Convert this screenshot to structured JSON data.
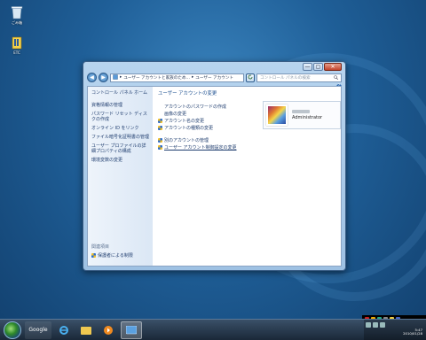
{
  "desktop": {
    "icons": [
      {
        "label": "ごみ箱",
        "icon": "recycle-bin-icon"
      },
      {
        "label": "ETC",
        "icon": "folder-icon"
      }
    ]
  },
  "window": {
    "caption_buttons": {
      "minimize": "—",
      "maximize": "▢",
      "close": "✕"
    },
    "nav": {
      "back": "◀",
      "forward": "▶"
    },
    "address": {
      "segments": [
        "ユーザー アカウントと家族のため...",
        "ユーザー アカウント"
      ],
      "separator": "▸"
    },
    "search": {
      "placeholder": "コントロール パネルの検索"
    },
    "help": "?"
  },
  "left_pane": {
    "home": "コントロール パネル ホーム",
    "links": [
      "資格情報の管理",
      "パスワード リセット ディスクの作成",
      "オンライン ID をリンク",
      "ファイル暗号化証明書の管理",
      "ユーザー プロファイルの詳細プロパティの構成",
      "環境変数の変更"
    ],
    "see_also": "関連項目",
    "parental": "保護者による制限"
  },
  "main": {
    "title": "ユーザー アカウントの変更",
    "tasks": [
      {
        "label": "アカウントのパスワードの作成",
        "icon": "none"
      },
      {
        "label": "画像の変更",
        "icon": "none"
      },
      {
        "label": "アカウント名の変更",
        "icon": "uac-shield-icon"
      },
      {
        "label": "アカウントの種類の変更",
        "icon": "uac-shield-icon"
      }
    ],
    "tasks2": [
      {
        "label": "別のアカウントの管理",
        "icon": "uac-shield-icon"
      },
      {
        "label": "ユーザー アカウント制御設定の変更",
        "icon": "uac-shield-icon"
      }
    ],
    "user": {
      "role": "Administrator"
    }
  },
  "taskbar": {
    "google_label": "Google",
    "clock_time": "5:47",
    "clock_date": "2010/01/28"
  }
}
